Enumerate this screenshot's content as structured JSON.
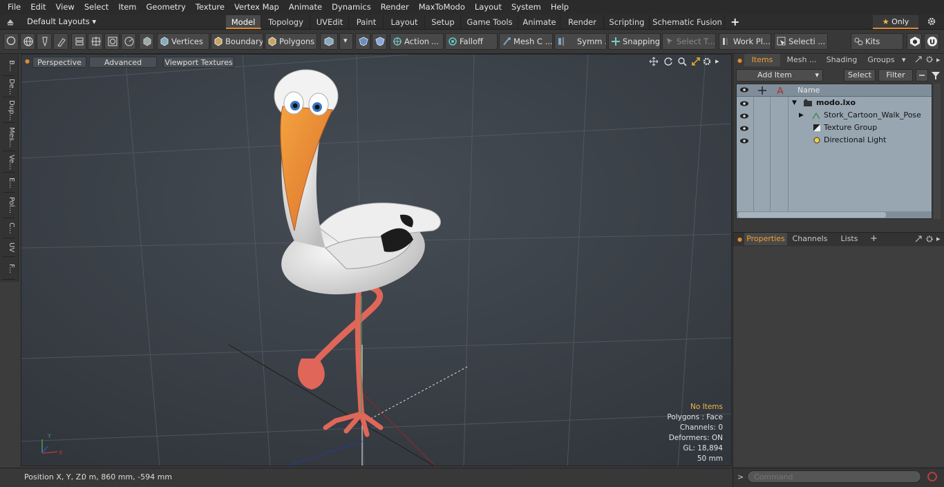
{
  "menubar": {
    "items": [
      "File",
      "Edit",
      "View",
      "Select",
      "Item",
      "Geometry",
      "Texture",
      "Vertex Map",
      "Animate",
      "Dynamics",
      "Render",
      "MaxToModo",
      "Layout",
      "System",
      "Help"
    ]
  },
  "layouts": {
    "label": "Default Layouts"
  },
  "tabs": {
    "items": [
      "Model",
      "Topology",
      "UVEdit",
      "Paint",
      "Layout",
      "Setup",
      "Game Tools",
      "Animate",
      "Render",
      "Scripting",
      "Schematic Fusion"
    ],
    "active": "Model",
    "add_label": "+",
    "only_label": "Only"
  },
  "toolbar": {
    "vertices": "Vertices",
    "boundary": "Boundary",
    "polygons": "Polygons",
    "action": "Action",
    "falloff": "Falloff",
    "mesh": "Mesh C ...",
    "symm": "Symm ...",
    "snapping": "Snapping",
    "select_t": "Select T...",
    "work_pl": "Work Pl...",
    "selecti": "Selecti ...",
    "kits": "Kits",
    "action_more": "..."
  },
  "left_strip": {
    "tabs": [
      "B...",
      "De...",
      "Dup...",
      "Mes...",
      "Ve...",
      "E...",
      "Pol...",
      "C...",
      "UV",
      "F..."
    ]
  },
  "viewport": {
    "perspective": "Perspective",
    "advanced": "Advanced",
    "viewport_textures": "Viewport Textures",
    "info": {
      "no_items": "No Items",
      "polygons": "Polygons : Face",
      "channels": "Channels: 0",
      "deformers": "Deformers: ON",
      "gl": "GL: 18,894",
      "scale": "50 mm"
    },
    "axis": {
      "y": "Y",
      "x": "X"
    }
  },
  "status": {
    "position_label": "Position X, Y, Z:",
    "position_value": "0 m, 860 mm, -594 mm"
  },
  "items_panel": {
    "tabs": [
      "Items",
      "Mesh ...",
      "Shading",
      "Groups"
    ],
    "active_tab": "Items",
    "add_item": "Add Item",
    "select": "Select",
    "filter": "Filter",
    "name_header": "Name",
    "rows": [
      "modo.lxo",
      "Stork_Cartoon_Walk_Pose",
      "Texture Group",
      "Directional Light"
    ]
  },
  "properties_panel": {
    "tabs": [
      "Properties",
      "Channels",
      "Lists"
    ],
    "active_tab": "Properties",
    "add_label": "+"
  },
  "command": {
    "placeholder": "Command"
  },
  "colors": {
    "accent": "#e08a2e",
    "viewport_bg": "#3b4148",
    "list_bg": "#98a6b2",
    "info_highlight": "#f5b642"
  }
}
